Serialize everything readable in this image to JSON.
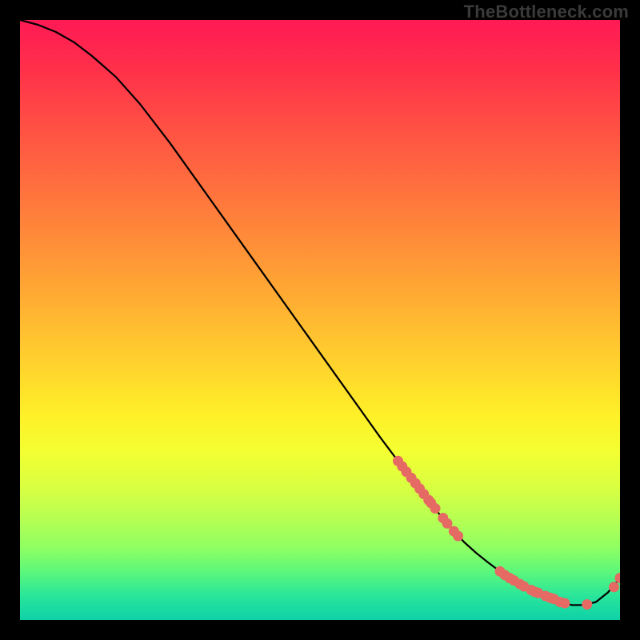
{
  "attribution": "TheBottleneck.com",
  "colors": {
    "line": "#000000",
    "dot_fill": "#e56a63",
    "dot_stroke": "#b24640"
  },
  "chart_data": {
    "type": "line",
    "title": "",
    "xlabel": "",
    "ylabel": "",
    "xlim": [
      0,
      100
    ],
    "ylim": [
      0,
      100
    ],
    "grid": false,
    "series": [
      {
        "name": "curve",
        "x": [
          0,
          3,
          6,
          9,
          12,
          16,
          20,
          25,
          30,
          35,
          40,
          45,
          50,
          55,
          60,
          63,
          66,
          69,
          72,
          74,
          76,
          78,
          80,
          82,
          84,
          86,
          88,
          90,
          92,
          94,
          96,
          98,
          100
        ],
        "y": [
          100,
          99.2,
          98.0,
          96.3,
          94.0,
          90.5,
          86.0,
          79.5,
          72.5,
          65.5,
          58.5,
          51.5,
          44.5,
          37.5,
          30.5,
          26.5,
          22.5,
          18.7,
          15.2,
          13.0,
          11.2,
          9.6,
          8.1,
          6.8,
          5.6,
          4.5,
          3.6,
          2.9,
          2.5,
          2.5,
          3.0,
          4.6,
          7.0
        ]
      }
    ],
    "dot_clusters": [
      {
        "name": "descent-cluster",
        "points": [
          [
            63.0,
            26.5
          ],
          [
            63.7,
            25.6
          ],
          [
            64.4,
            24.7
          ],
          [
            65.2,
            23.7
          ],
          [
            65.9,
            22.8
          ],
          [
            66.6,
            21.9
          ],
          [
            67.3,
            21.0
          ],
          [
            68.1,
            20.0
          ],
          [
            68.5,
            19.5
          ],
          [
            69.2,
            18.6
          ],
          [
            70.5,
            17.0
          ],
          [
            71.2,
            16.1
          ],
          [
            72.3,
            14.8
          ],
          [
            73.0,
            14.0
          ]
        ]
      },
      {
        "name": "trough-cluster",
        "points": [
          [
            80.0,
            8.1
          ],
          [
            80.8,
            7.5
          ],
          [
            81.6,
            7.0
          ],
          [
            82.3,
            6.6
          ],
          [
            83.3,
            6.0
          ],
          [
            84.0,
            5.6
          ],
          [
            85.2,
            5.0
          ],
          [
            85.8,
            4.7
          ],
          [
            86.4,
            4.5
          ],
          [
            87.6,
            4.0
          ],
          [
            88.4,
            3.7
          ],
          [
            89.0,
            3.5
          ],
          [
            90.0,
            3.0
          ],
          [
            90.8,
            2.8
          ],
          [
            94.5,
            2.6
          ]
        ]
      },
      {
        "name": "upturn-cluster",
        "points": [
          [
            99.0,
            5.5
          ],
          [
            100.0,
            7.0
          ]
        ]
      }
    ]
  }
}
